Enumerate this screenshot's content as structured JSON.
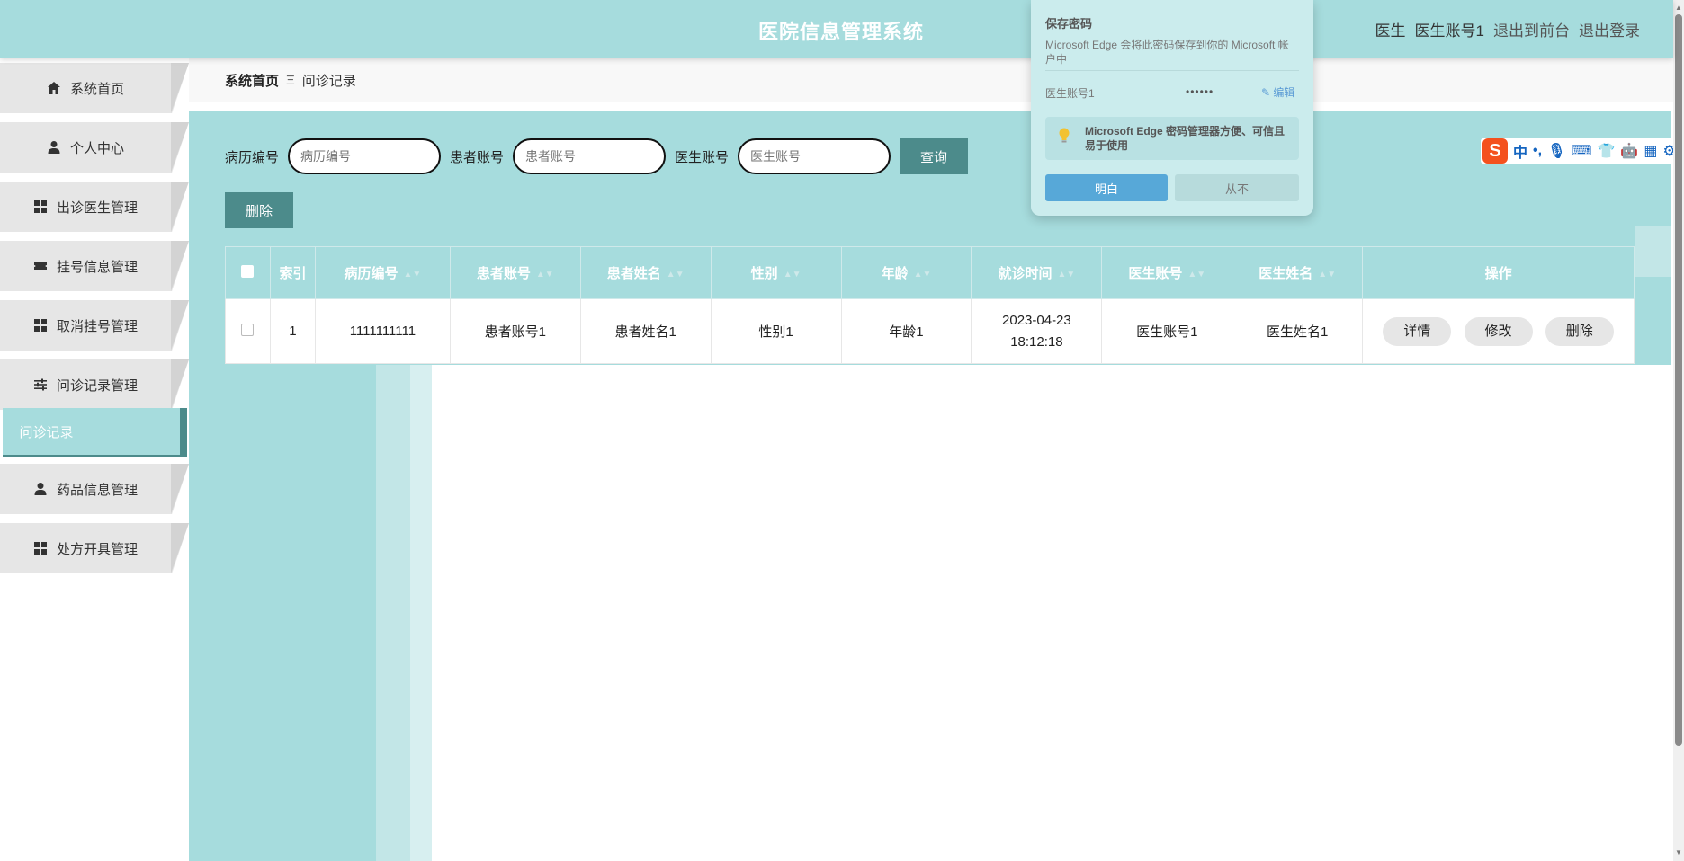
{
  "header": {
    "title": "医院信息管理系统",
    "role": "医生",
    "username": "医生账号1",
    "back_to_front": "退出到前台",
    "logout": "退出登录"
  },
  "sidebar": {
    "items": [
      {
        "label": "系统首页",
        "icon": "home-icon"
      },
      {
        "label": "个人中心",
        "icon": "user-icon"
      },
      {
        "label": "出诊医生管理",
        "icon": "grid-icon"
      },
      {
        "label": "挂号信息管理",
        "icon": "ticket-icon"
      },
      {
        "label": "取消挂号管理",
        "icon": "grid-icon"
      },
      {
        "label": "问诊记录管理",
        "icon": "sliders-icon"
      },
      {
        "label": "药品信息管理",
        "icon": "user-icon"
      },
      {
        "label": "处方开具管理",
        "icon": "grid-icon"
      }
    ],
    "active_sub": "问诊记录"
  },
  "breadcrumb": {
    "home": "系统首页",
    "sep": "Ξ",
    "current": "问诊记录"
  },
  "search": {
    "f1_label": "病历编号",
    "f1_placeholder": "病历编号",
    "f2_label": "患者账号",
    "f2_placeholder": "患者账号",
    "f3_label": "医生账号",
    "f3_placeholder": "医生账号",
    "query": "查询"
  },
  "actions": {
    "delete": "删除"
  },
  "table": {
    "headers": [
      "索引",
      "病历编号",
      "患者账号",
      "患者姓名",
      "性别",
      "年龄",
      "就诊时间",
      "医生账号",
      "医生姓名",
      "操作"
    ],
    "rows": [
      {
        "index": "1",
        "record_no": "1111111111",
        "patient_acc": "患者账号1",
        "patient_name": "患者姓名1",
        "gender": "性别1",
        "age": "年龄1",
        "visit_time": "2023-04-23 18:12:18",
        "doctor_acc": "医生账号1",
        "doctor_name": "医生姓名1"
      }
    ],
    "row_actions": {
      "detail": "详情",
      "edit": "修改",
      "delete": "删除"
    }
  },
  "ime": {
    "logo": "S",
    "glyphs": [
      "中",
      "•,",
      "🎙",
      "⌨",
      "👕",
      "🤖",
      "▦",
      "⚙"
    ]
  },
  "password_popup": {
    "title": "保存密码",
    "desc": "Microsoft Edge 会将此密码保存到你的 Microsoft 帐户中",
    "username": "医生账号1",
    "password": "••••••",
    "edit": "编辑",
    "tip": "Microsoft Edge 密码管理器方便、可信且易于使用",
    "ok": "明白",
    "never": "从不"
  },
  "colors": {
    "theme": "#a6dcdd",
    "accent": "#4c8b8b",
    "popup_primary": "#57a8d8"
  }
}
